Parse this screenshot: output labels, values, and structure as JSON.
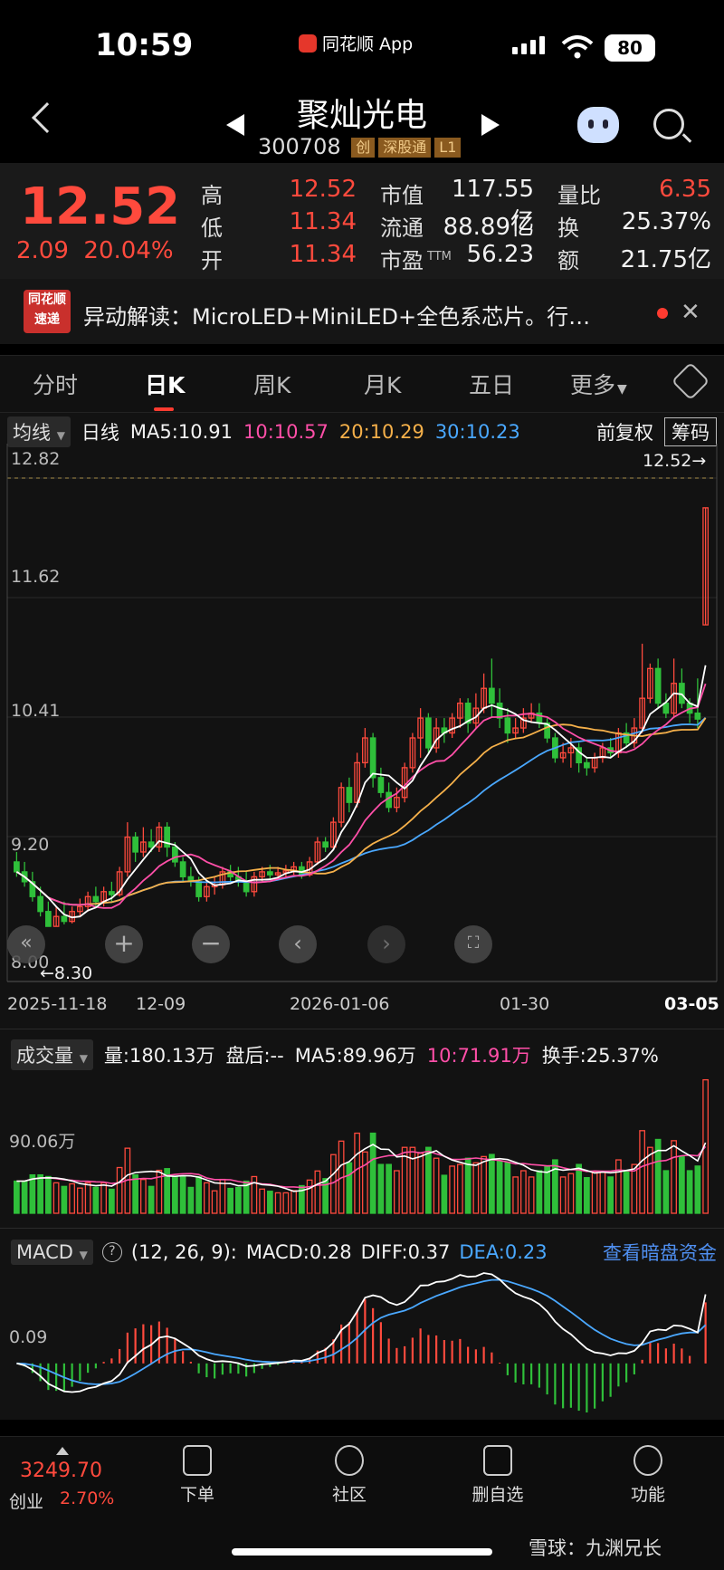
{
  "status": {
    "time": "10:59",
    "app": "同花顺 App",
    "battery": "80"
  },
  "header": {
    "title": "聚灿光电",
    "code": "300708",
    "tags": [
      "创",
      "深股通",
      "L1"
    ]
  },
  "quote": {
    "price": "12.52",
    "change": "2.09",
    "change_pct": "20.04%",
    "labels": {
      "high": "高",
      "low": "低",
      "open": "开",
      "mktcap": "市值",
      "float": "流通",
      "pe": "市盈",
      "pe_sup": "TTM",
      "vol_ratio": "量比",
      "turnover": "换",
      "amount": "额"
    },
    "high": "12.52",
    "low": "11.34",
    "open": "11.34",
    "mktcap": "117.55亿",
    "float": "88.89亿",
    "pe": "56.23",
    "vol_ratio": "6.35",
    "turnover": "25.37%",
    "amount": "21.75亿"
  },
  "news": {
    "logo_top": "同花顺",
    "logo_bottom": "速递",
    "text": "异动解读：MicroLED+MiniLED+全色系芯片。行…"
  },
  "tabs": [
    "分时",
    "日K",
    "周K",
    "月K",
    "五日",
    "更多"
  ],
  "kline": {
    "mode": "均线",
    "period": "日线",
    "ma5": "MA5:10.91",
    "ma10": "10:10.57",
    "ma20": "20:10.29",
    "ma30": "30:10.23",
    "adjust": "前复权",
    "chips": "筹码",
    "y_labels": [
      "12.82",
      "11.62",
      "10.41",
      "9.20",
      "8.00"
    ],
    "high_mark": "12.52→",
    "low_mark": "←8.30",
    "dates": [
      "2025-11-18",
      "12-09",
      "2026-01-06",
      "01-30",
      "03-05"
    ]
  },
  "volume": {
    "label": "成交量",
    "vol": "量:180.13万",
    "after": "盘后:--",
    "ma5": "MA5:89.96万",
    "ma10": "10:71.91万",
    "turnover": "换手:25.37%",
    "y_label": "90.06万"
  },
  "macd": {
    "label": "MACD",
    "params": "(12, 26, 9):",
    "macd": "MACD:0.28",
    "diff": "DIFF:0.37",
    "dea": "DEA:0.23",
    "link": "查看暗盘资金",
    "y_label": "0.09"
  },
  "bottom": {
    "index_value": "3249.70",
    "index_name": "创业",
    "index_pct": "2.70%",
    "items": [
      "下单",
      "社区",
      "删自选",
      "功能"
    ]
  },
  "watermark": "雪球：九渊兄长",
  "colors": {
    "up": "#ff4a3d",
    "down": "#2fbf3a",
    "ma5": "#ffffff",
    "ma10": "#ff4fa8",
    "ma20": "#f5b04a",
    "ma30": "#4aa8ff"
  },
  "chart_data": {
    "type": "candlestick",
    "ylim": [
      8.0,
      12.82
    ],
    "candles": [
      [
        8.95,
        8.85,
        9.05,
        8.8
      ],
      [
        8.85,
        8.75,
        8.95,
        8.7
      ],
      [
        8.75,
        8.6,
        8.85,
        8.55
      ],
      [
        8.6,
        8.45,
        8.7,
        8.4
      ],
      [
        8.45,
        8.3,
        8.55,
        8.3
      ],
      [
        8.3,
        8.4,
        8.5,
        8.3
      ],
      [
        8.4,
        8.35,
        8.55,
        8.32
      ],
      [
        8.35,
        8.45,
        8.5,
        8.33
      ],
      [
        8.45,
        8.5,
        8.58,
        8.4
      ],
      [
        8.5,
        8.6,
        8.65,
        8.45
      ],
      [
        8.6,
        8.55,
        8.7,
        8.5
      ],
      [
        8.55,
        8.65,
        8.7,
        8.5
      ],
      [
        8.65,
        8.62,
        8.75,
        8.55
      ],
      [
        8.62,
        8.85,
        8.9,
        8.6
      ],
      [
        8.85,
        9.2,
        9.35,
        8.8
      ],
      [
        9.2,
        9.05,
        9.25,
        8.95
      ],
      [
        9.05,
        9.15,
        9.3,
        9.0
      ],
      [
        9.15,
        9.1,
        9.28,
        9.05
      ],
      [
        9.1,
        9.3,
        9.35,
        9.05
      ],
      [
        9.3,
        9.1,
        9.35,
        9.0
      ],
      [
        9.1,
        8.95,
        9.15,
        8.9
      ],
      [
        8.95,
        8.8,
        9.0,
        8.75
      ],
      [
        8.8,
        8.75,
        8.9,
        8.7
      ],
      [
        8.75,
        8.6,
        8.8,
        8.55
      ],
      [
        8.6,
        8.7,
        8.75,
        8.55
      ],
      [
        8.7,
        8.72,
        8.8,
        8.62
      ],
      [
        8.72,
        8.85,
        8.9,
        8.68
      ],
      [
        8.85,
        8.8,
        8.92,
        8.75
      ],
      [
        8.8,
        8.75,
        8.9,
        8.7
      ],
      [
        8.75,
        8.65,
        8.85,
        8.6
      ],
      [
        8.65,
        8.8,
        8.85,
        8.6
      ],
      [
        8.8,
        8.85,
        8.9,
        8.75
      ],
      [
        8.85,
        8.82,
        8.92,
        8.78
      ],
      [
        8.82,
        8.84,
        8.9,
        8.78
      ],
      [
        8.84,
        8.86,
        8.92,
        8.8
      ],
      [
        8.86,
        8.9,
        8.95,
        8.82
      ],
      [
        8.9,
        8.82,
        8.95,
        8.78
      ],
      [
        8.82,
        8.95,
        9.0,
        8.8
      ],
      [
        8.95,
        9.15,
        9.2,
        8.92
      ],
      [
        9.15,
        9.1,
        9.2,
        9.05
      ],
      [
        9.1,
        9.35,
        9.4,
        9.08
      ],
      [
        9.35,
        9.7,
        9.75,
        9.3
      ],
      [
        9.7,
        9.55,
        9.8,
        9.45
      ],
      [
        9.55,
        9.95,
        10.05,
        9.5
      ],
      [
        9.95,
        10.2,
        10.3,
        9.9
      ],
      [
        10.2,
        9.8,
        10.25,
        9.7
      ],
      [
        9.8,
        9.65,
        9.9,
        9.6
      ],
      [
        9.65,
        9.5,
        9.75,
        9.45
      ],
      [
        9.5,
        9.6,
        9.7,
        9.45
      ],
      [
        9.6,
        9.9,
        9.95,
        9.55
      ],
      [
        9.9,
        10.2,
        10.25,
        9.85
      ],
      [
        10.2,
        10.4,
        10.5,
        10.0
      ],
      [
        10.4,
        10.1,
        10.45,
        10.05
      ],
      [
        10.1,
        10.3,
        10.4,
        10.05
      ],
      [
        10.3,
        10.25,
        10.4,
        10.15
      ],
      [
        10.25,
        10.4,
        10.45,
        10.2
      ],
      [
        10.4,
        10.55,
        10.6,
        10.3
      ],
      [
        10.55,
        10.35,
        10.6,
        10.25
      ],
      [
        10.35,
        10.5,
        10.65,
        10.3
      ],
      [
        10.5,
        10.7,
        10.85,
        10.45
      ],
      [
        10.7,
        10.55,
        11.0,
        10.4
      ],
      [
        10.55,
        10.4,
        10.7,
        10.3
      ],
      [
        10.4,
        10.25,
        10.5,
        10.15
      ],
      [
        10.25,
        10.3,
        10.4,
        10.2
      ],
      [
        10.3,
        10.4,
        10.5,
        10.25
      ],
      [
        10.4,
        10.45,
        10.55,
        10.35
      ],
      [
        10.45,
        10.35,
        10.55,
        10.3
      ],
      [
        10.35,
        10.2,
        10.4,
        10.15
      ],
      [
        10.2,
        10.0,
        10.25,
        9.95
      ],
      [
        10.0,
        10.05,
        10.15,
        9.95
      ],
      [
        10.05,
        10.1,
        10.2,
        9.9
      ],
      [
        10.1,
        9.95,
        10.15,
        9.85
      ],
      [
        9.95,
        9.9,
        10.0,
        9.82
      ],
      [
        9.9,
        10.0,
        10.05,
        9.85
      ],
      [
        10.0,
        10.1,
        10.15,
        9.95
      ],
      [
        10.1,
        10.05,
        10.2,
        10.0
      ],
      [
        10.05,
        10.25,
        10.3,
        10.0
      ],
      [
        10.25,
        10.15,
        10.35,
        10.1
      ],
      [
        10.15,
        10.3,
        10.4,
        10.1
      ],
      [
        10.3,
        10.6,
        11.15,
        10.25
      ],
      [
        10.6,
        10.9,
        10.95,
        10.55
      ],
      [
        10.9,
        10.55,
        11.0,
        10.5
      ],
      [
        10.55,
        10.45,
        10.65,
        10.4
      ],
      [
        10.45,
        10.75,
        11.0,
        10.4
      ],
      [
        10.75,
        10.55,
        10.9,
        10.5
      ],
      [
        10.55,
        10.45,
        10.6,
        10.35
      ],
      [
        10.45,
        10.39,
        10.8,
        10.3
      ],
      [
        11.34,
        12.52,
        12.52,
        11.34
      ]
    ]
  }
}
